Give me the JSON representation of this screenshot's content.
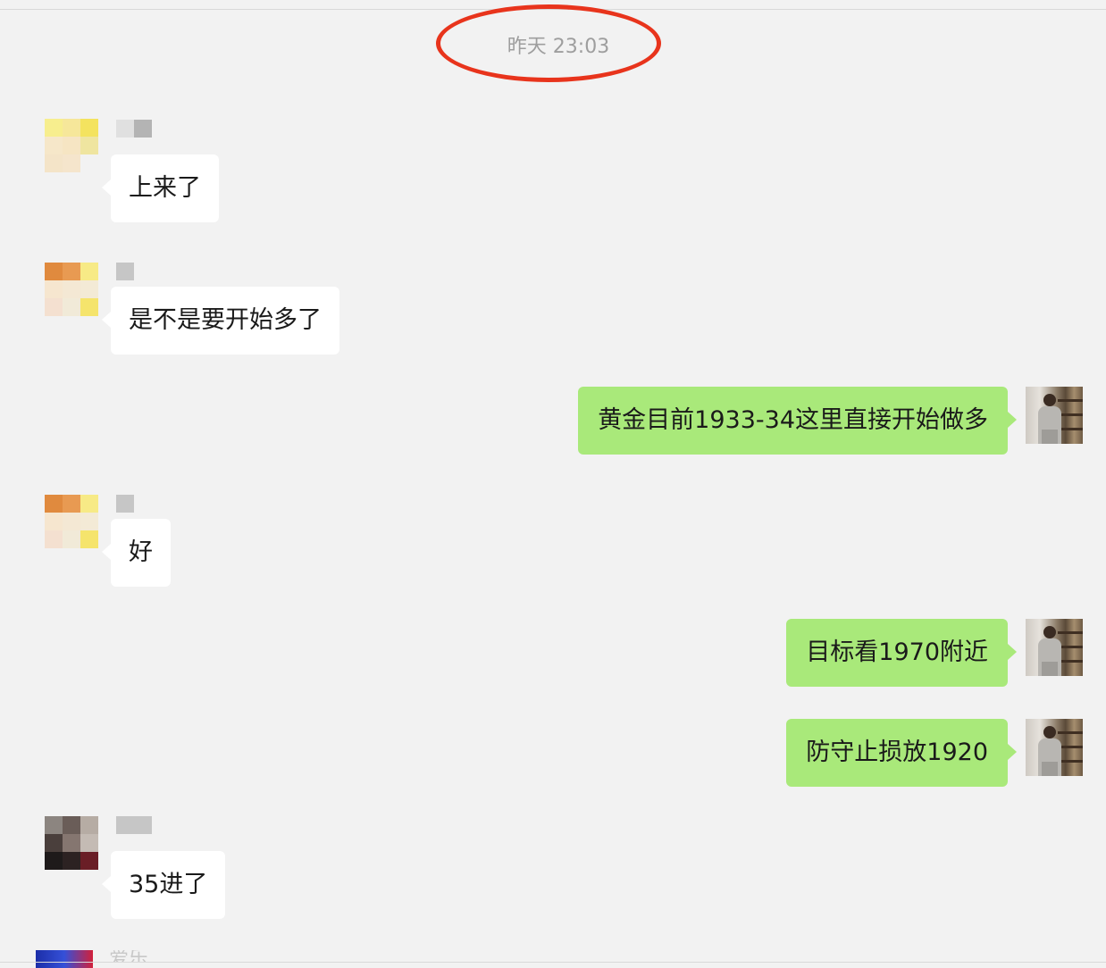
{
  "timestamp": "昨天 23:03",
  "messages": [
    {
      "direction": "in",
      "text": "上来了"
    },
    {
      "direction": "in",
      "text": "是不是要开始多了"
    },
    {
      "direction": "out",
      "text": "黄金目前1933-34这里直接开始做多"
    },
    {
      "direction": "in",
      "text": "好"
    },
    {
      "direction": "out",
      "text": "目标看1970附近"
    },
    {
      "direction": "out",
      "text": "防守止损放1920"
    },
    {
      "direction": "in",
      "text": "35进了"
    }
  ],
  "partial_next_sender": "爱乐",
  "colors": {
    "background": "#f2f2f2",
    "incoming_bubble": "#ffffff",
    "outgoing_bubble": "#a9e97a",
    "annotation_circle": "#e8341c"
  }
}
